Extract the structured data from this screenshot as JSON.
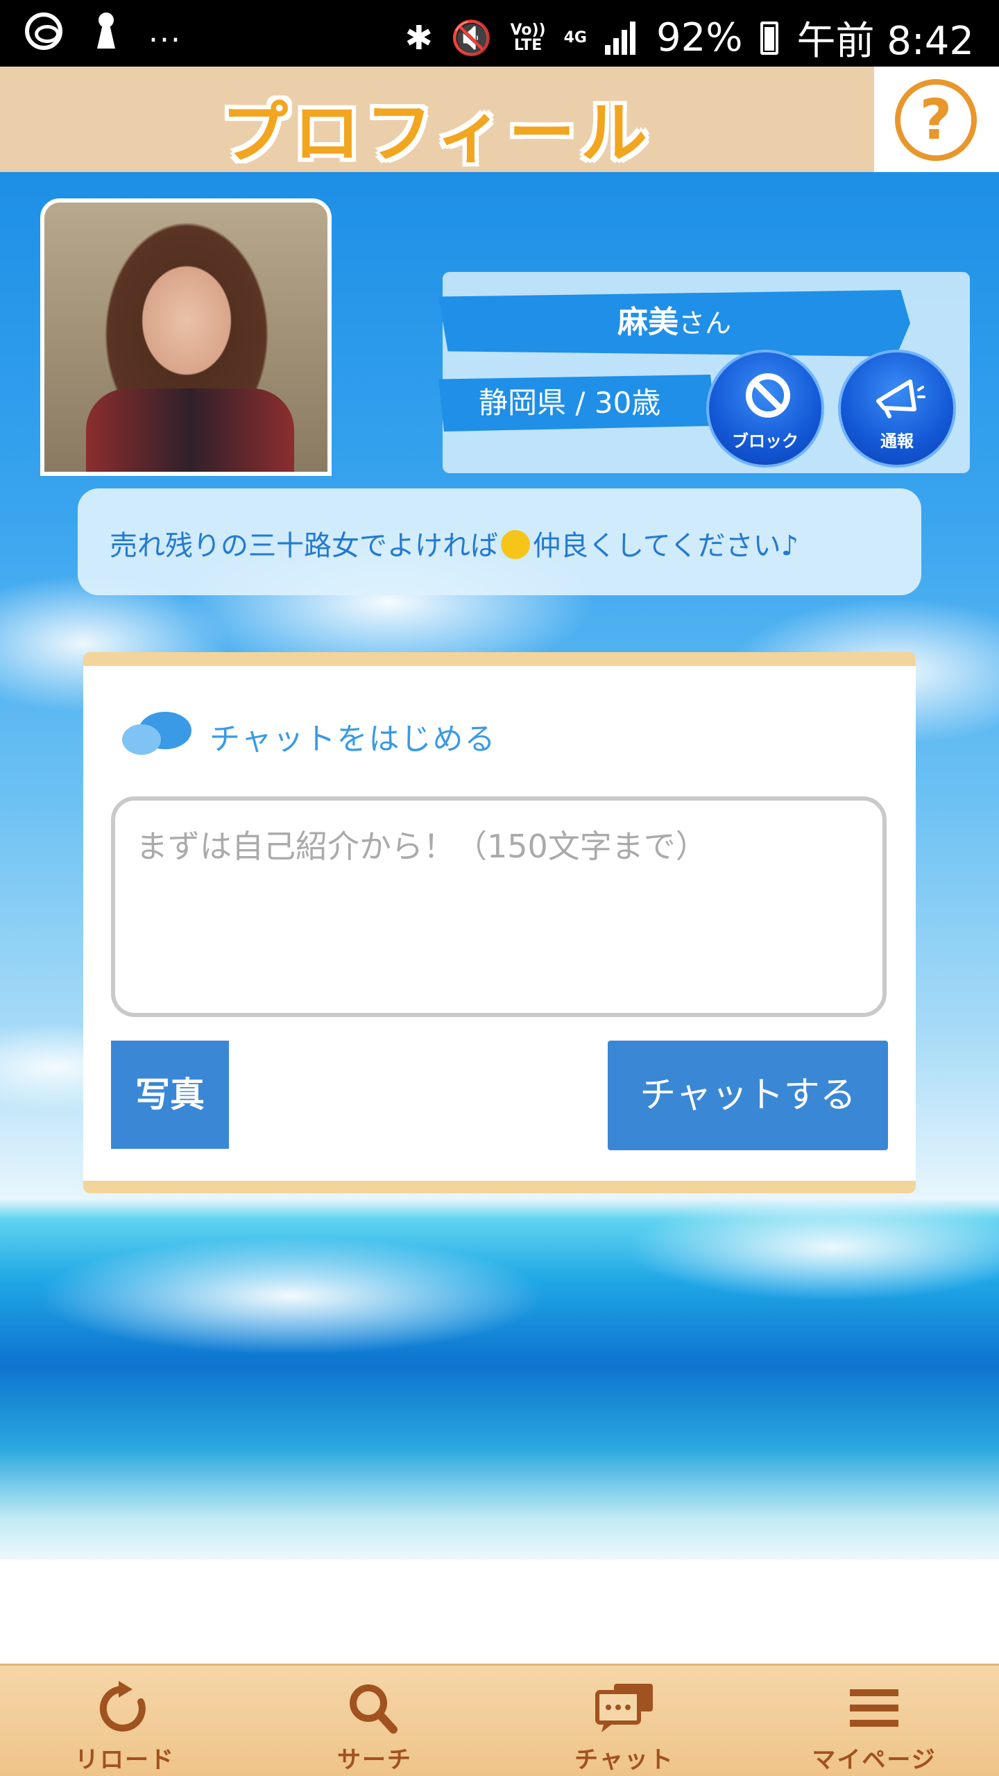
{
  "status_bar": {
    "dots": "...",
    "battery": "92%",
    "time": "午前 8:42",
    "network": "4G",
    "volte_line1": "Vo))",
    "volte_line2": "LTE"
  },
  "header": {
    "title": "プロフィール",
    "help_icon": "question-icon",
    "help_label": "?"
  },
  "profile": {
    "name": "麻美",
    "honorific": "さん",
    "location_age": "静岡県 / 30歳",
    "block_label": "ブロック",
    "report_label": "通報",
    "bio": "売れ残りの三十路女でよければ",
    "bio_tail": "仲良くしてください♪"
  },
  "chat": {
    "title": "チャットをはじめる",
    "placeholder": "まずは自己紹介から！（150文字まで）",
    "value": "",
    "photo_label": "写真",
    "send_label": "チャットする"
  },
  "nav": {
    "items": [
      {
        "label": "リロード",
        "icon": "reload-icon"
      },
      {
        "label": "サーチ",
        "icon": "search-icon"
      },
      {
        "label": "チャット",
        "icon": "chat-icon"
      },
      {
        "label": "マイページ",
        "icon": "menu-icon"
      }
    ]
  },
  "colors": {
    "header_bg": "#ebcfaa",
    "accent_orange": "#f2a51f",
    "button_blue": "#3a87d6",
    "nav_label": "#a0521f"
  }
}
